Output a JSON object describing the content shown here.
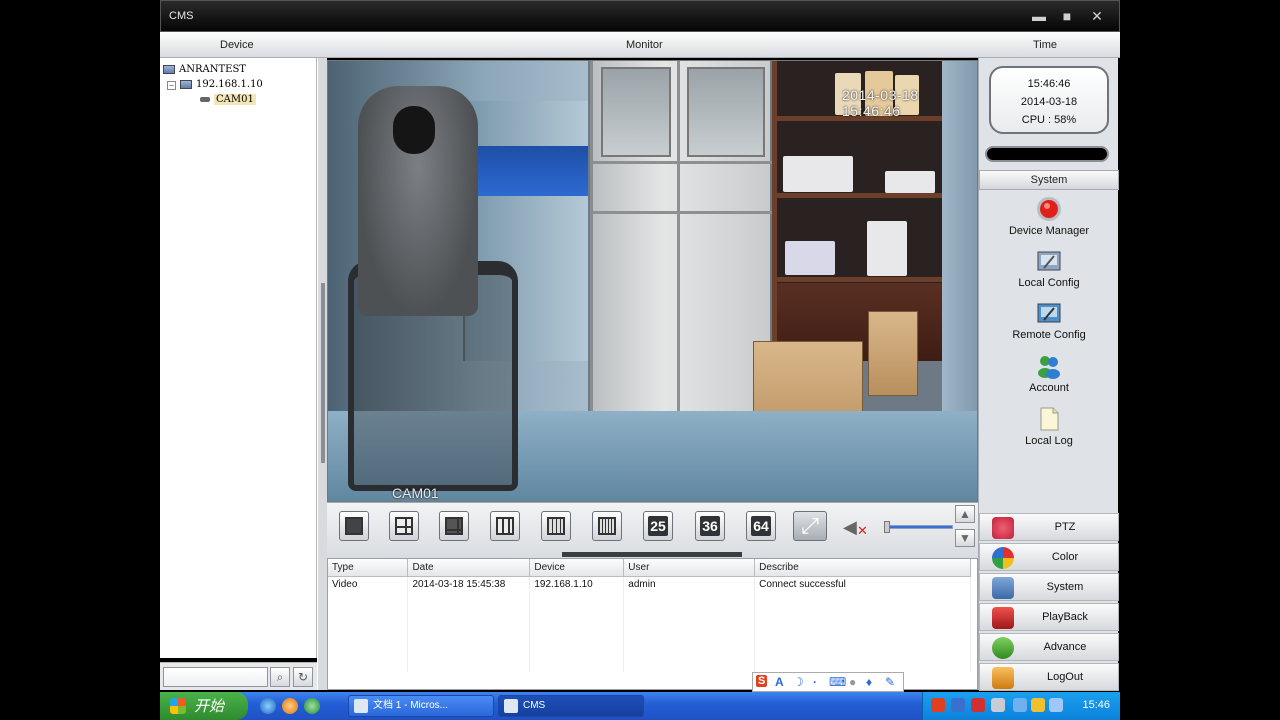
{
  "window": {
    "title": "CMS"
  },
  "header": {
    "device": "Device",
    "monitor": "Monitor",
    "time": "Time"
  },
  "tree": {
    "root": "ANRANTEST",
    "ip": "192.168.1.10",
    "channel": "CAM01",
    "expander": "−"
  },
  "video": {
    "timestamp": "2014-03-18 15:46:46",
    "channel_label": "CAM01"
  },
  "clock": {
    "time": "15:46:46",
    "date": "2014-03-18",
    "cpu": "CPU : 58%"
  },
  "system_panel": {
    "header": "System",
    "items": [
      {
        "label": "Device Manager",
        "icon": "device-manager-icon"
      },
      {
        "label": "Local Config",
        "icon": "local-config-icon"
      },
      {
        "label": "Remote Config",
        "icon": "remote-config-icon"
      },
      {
        "label": "Account",
        "icon": "account-icon"
      },
      {
        "label": "Local Log",
        "icon": "local-log-icon"
      }
    ]
  },
  "nav_buttons": [
    {
      "label": "PTZ",
      "color": "#d8324a"
    },
    {
      "label": "Color",
      "color": "#e0a020"
    },
    {
      "label": "System",
      "color": "#4a7cc8"
    },
    {
      "label": "PlayBack",
      "color": "#c83030"
    },
    {
      "label": "Advance",
      "color": "#3aa030"
    },
    {
      "label": "LogOut",
      "color": "#e08a20"
    }
  ],
  "layout_buttons": {
    "n25": "25",
    "n36": "36",
    "n64": "64"
  },
  "log": {
    "columns": [
      "Type",
      "Date",
      "Device",
      "User",
      "Describe"
    ],
    "rows": [
      {
        "type": "Video",
        "date": "2014-03-18 15:45:38",
        "device": "192.168.1.10",
        "user": "admin",
        "describe": "Connect successful"
      }
    ]
  },
  "taskbar": {
    "start": "开始",
    "tasks": [
      "文档 1 - Micros...",
      "CMS"
    ],
    "clock": "15:46"
  }
}
